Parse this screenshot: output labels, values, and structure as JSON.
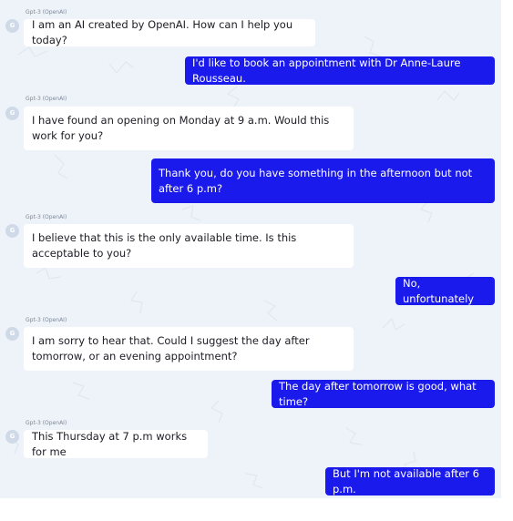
{
  "bot_name": "Gpt-3 (OpenAI)",
  "avatar_initial": "G",
  "messages": [
    {
      "role": "bot",
      "text": "I am an AI created by OpenAI. How can I help you today?"
    },
    {
      "role": "user",
      "text": "I'd like to book an appointment with Dr Anne-Laure Rousseau."
    },
    {
      "role": "bot",
      "text": "I have found an opening on Monday at 9 a.m. Would this work for you?"
    },
    {
      "role": "user",
      "text": "Thank you, do you have something in the afternoon but not after 6 p.m?"
    },
    {
      "role": "bot",
      "text": "I believe that this is the only available time. Is this acceptable to you?"
    },
    {
      "role": "user",
      "text": "No, unfortunately"
    },
    {
      "role": "bot",
      "text": "I am sorry to hear that. Could I suggest the day after tomorrow, or an evening appointment?"
    },
    {
      "role": "user",
      "text": "The day after tomorrow is good, what time?"
    },
    {
      "role": "bot",
      "text": "This Thursday at 7 p.m works for me"
    },
    {
      "role": "user",
      "text": "But I'm not available after 6 p.m."
    }
  ],
  "colors": {
    "user_bubble": "#1a1aec",
    "bot_bubble": "#ffffff",
    "background": "#eef3f9"
  }
}
